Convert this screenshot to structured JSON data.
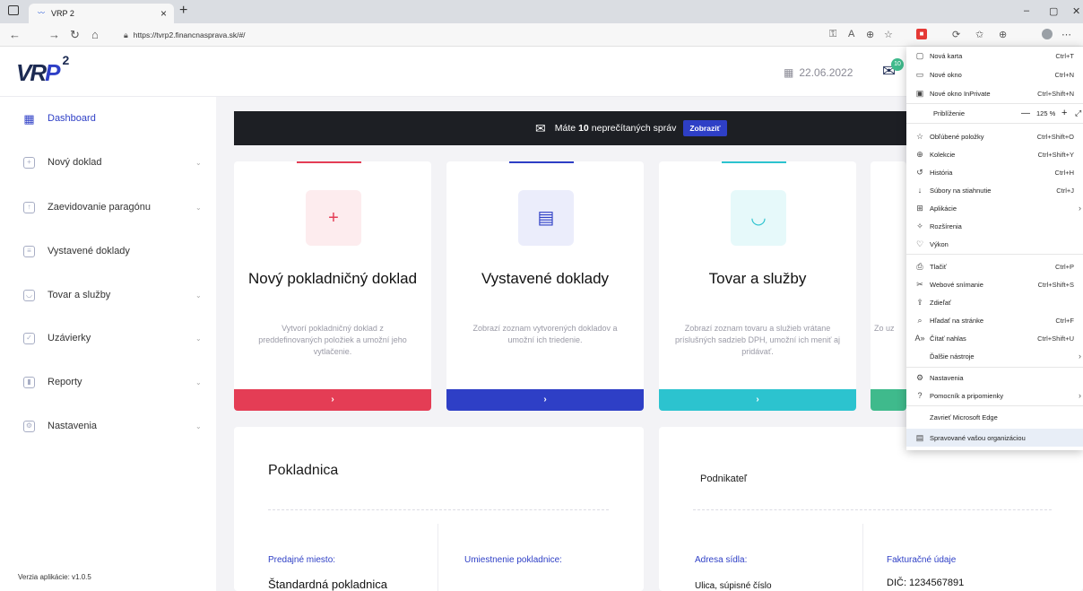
{
  "browser": {
    "tab_title": "VRP 2",
    "tab_close": "×",
    "new_tab": "+",
    "url": "https://tvrp2.financnasprava.sk/#/",
    "window_controls": [
      "–",
      "▢",
      "✕"
    ]
  },
  "app": {
    "logo_main": "VR",
    "logo_accent": "P",
    "logo_sup": "2",
    "date": "22.06.2022",
    "mail_badge": "10"
  },
  "sidebar": {
    "items": [
      {
        "label": "Dashboard",
        "icon": "dashboard-icon",
        "glyph": "▦",
        "chevron": ""
      },
      {
        "label": "Nový doklad",
        "icon": "new-doc-icon",
        "glyph": "+",
        "chevron": "⌄"
      },
      {
        "label": "Zaevidovanie paragónu",
        "icon": "receipt-upload-icon",
        "glyph": "↑",
        "chevron": "⌄"
      },
      {
        "label": "Vystavené doklady",
        "icon": "issued-docs-icon",
        "glyph": "≡",
        "chevron": ""
      },
      {
        "label": "Tovar a služby",
        "icon": "goods-icon",
        "glyph": "◡",
        "chevron": "⌄"
      },
      {
        "label": "Uzávierky",
        "icon": "closure-icon",
        "glyph": "✓",
        "chevron": "⌄"
      },
      {
        "label": "Reporty",
        "icon": "reports-icon",
        "glyph": "▮",
        "chevron": "⌄"
      },
      {
        "label": "Nastavenia",
        "icon": "settings-icon",
        "glyph": "⚙",
        "chevron": "⌄"
      }
    ],
    "version": "Verzia aplikácie: v1.0.5"
  },
  "banner": {
    "prefix": "Máte",
    "count": "10",
    "suffix": "neprečítaných správ",
    "button": "Zobraziť"
  },
  "cards": [
    {
      "title": "Nový pokladničný doklad",
      "desc": "Vytvorí pokladničný doklad z preddefinovaných položiek a umožní jeho vytlačenie.",
      "glyph": "+",
      "accent": "#e43d55",
      "tint": "#fdecee",
      "go": "›"
    },
    {
      "title": "Vystavené doklady",
      "desc": "Zobrazí zoznam vytvorených dokladov a umožní ich triedenie.",
      "glyph": "▤",
      "accent": "#2e3fc6",
      "tint": "#ebedfb",
      "go": "›"
    },
    {
      "title": "Tovar a služby",
      "desc": "Zobrazí zoznam tovaru a služieb vrátane príslušných sadzieb DPH, umožní ich meniť aj pridávať.",
      "glyph": "◡",
      "accent": "#2cc3cf",
      "tint": "#e6f9fa",
      "go": "›"
    },
    {
      "title": "",
      "desc": "Zo uz",
      "glyph": "",
      "accent": "#3fba8c",
      "tint": "#ffffff",
      "go": ""
    }
  ],
  "panels": {
    "pokladnica": {
      "title": "Pokladnica",
      "label1": "Predajné miesto:",
      "value1": "Štandardná pokladnica",
      "label2": "Umiestnenie pokladnice:"
    },
    "podnikatel": {
      "title": "Podnikateľ",
      "label1": "Adresa sídla:",
      "value1": "Ulica, súpisné číslo",
      "label2": "Fakturačné údaje",
      "value2": "DIČ: 1234567891"
    }
  },
  "edge_menu": {
    "items": [
      {
        "label": "Nová karta",
        "shortcut": "Ctrl+T",
        "glyph": "▢"
      },
      {
        "label": "Nové okno",
        "shortcut": "Ctrl+N",
        "glyph": "▭"
      },
      {
        "label": "Nové okno InPrivate",
        "shortcut": "Ctrl+Shift+N",
        "glyph": "▣"
      },
      {
        "label": "Priblíženie",
        "shortcut": "",
        "glyph": ""
      },
      {
        "label": "Obľúbené položky",
        "shortcut": "Ctrl+Shift+O",
        "glyph": "☆"
      },
      {
        "label": "Kolekcie",
        "shortcut": "Ctrl+Shift+Y",
        "glyph": "⊕"
      },
      {
        "label": "História",
        "shortcut": "Ctrl+H",
        "glyph": "↺"
      },
      {
        "label": "Súbory na stiahnutie",
        "shortcut": "Ctrl+J",
        "glyph": "↓"
      },
      {
        "label": "Aplikácie",
        "shortcut": "",
        "glyph": "⊞",
        "arrow": "›"
      },
      {
        "label": "Rozšírenia",
        "shortcut": "",
        "glyph": "✧"
      },
      {
        "label": "Výkon",
        "shortcut": "",
        "glyph": "♡"
      },
      {
        "label": "Tlačiť",
        "shortcut": "Ctrl+P",
        "glyph": "⎙"
      },
      {
        "label": "Webové snímanie",
        "shortcut": "Ctrl+Shift+S",
        "glyph": "✂"
      },
      {
        "label": "Zdieľať",
        "shortcut": "",
        "glyph": "⇪"
      },
      {
        "label": "Hľadať na stránke",
        "shortcut": "Ctrl+F",
        "glyph": "⌕"
      },
      {
        "label": "Čítať nahlas",
        "shortcut": "Ctrl+Shift+U",
        "glyph": "A»"
      },
      {
        "label": "Ďalšie nástroje",
        "shortcut": "",
        "glyph": "",
        "arrow": "›"
      },
      {
        "label": "Nastavenia",
        "shortcut": "",
        "glyph": "⚙"
      },
      {
        "label": "Pomocník a pripomienky",
        "shortcut": "",
        "glyph": "?",
        "arrow": "›"
      },
      {
        "label": "Zavrieť Microsoft Edge",
        "shortcut": "",
        "glyph": ""
      },
      {
        "label": "Spravované vašou organizáciou",
        "shortcut": "",
        "glyph": "▤"
      }
    ],
    "zoom_minus": "—",
    "zoom_value": "125 %",
    "zoom_plus": "+",
    "zoom_full": "⤢"
  }
}
